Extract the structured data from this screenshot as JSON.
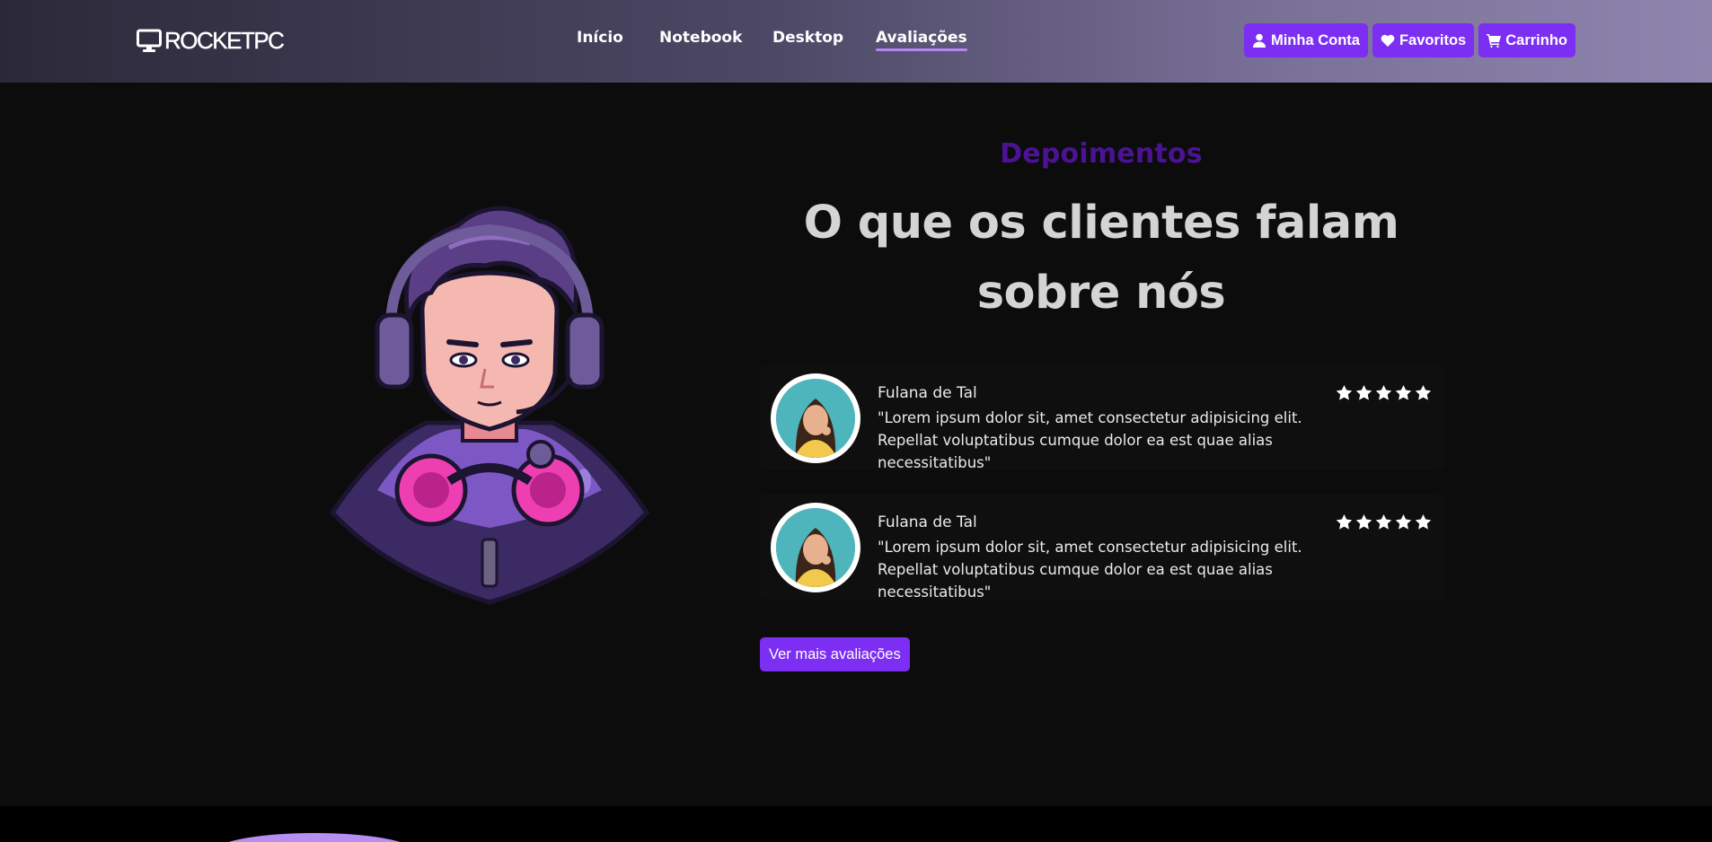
{
  "header": {
    "logo_text": "ROCKETPC",
    "nav": [
      {
        "label": "Início",
        "active": false
      },
      {
        "label": "Notebook",
        "active": false
      },
      {
        "label": "Desktop",
        "active": false
      },
      {
        "label": "Avaliações",
        "active": true
      }
    ],
    "actions": [
      {
        "label": "Minha Conta",
        "icon": "user-icon"
      },
      {
        "label": "Favoritos",
        "icon": "heart-icon"
      },
      {
        "label": "Carrinho",
        "icon": "cart-icon"
      }
    ]
  },
  "testimonials": {
    "eyebrow": "Depoimentos",
    "headline": "O que os clientes falam sobre nós",
    "reviews": [
      {
        "name": "Fulana de Tal",
        "quote": "\"Lorem ipsum dolor sit, amet consectetur adipisicing elit. Repellat voluptatibus cumque dolor ea est quae alias necessitatibus\"",
        "rating": 5
      },
      {
        "name": "Fulana de Tal",
        "quote": "\"Lorem ipsum dolor sit, amet consectetur adipisicing elit. Repellat voluptatibus cumque dolor ea est quae alias necessitatibus\"",
        "rating": 5
      }
    ],
    "more_button": "Ver mais avaliações"
  },
  "colors": {
    "accent": "#7c2ff2",
    "eyebrow": "#4b1393",
    "headline": "#d4d4d4",
    "background": "#0c0c0c"
  }
}
